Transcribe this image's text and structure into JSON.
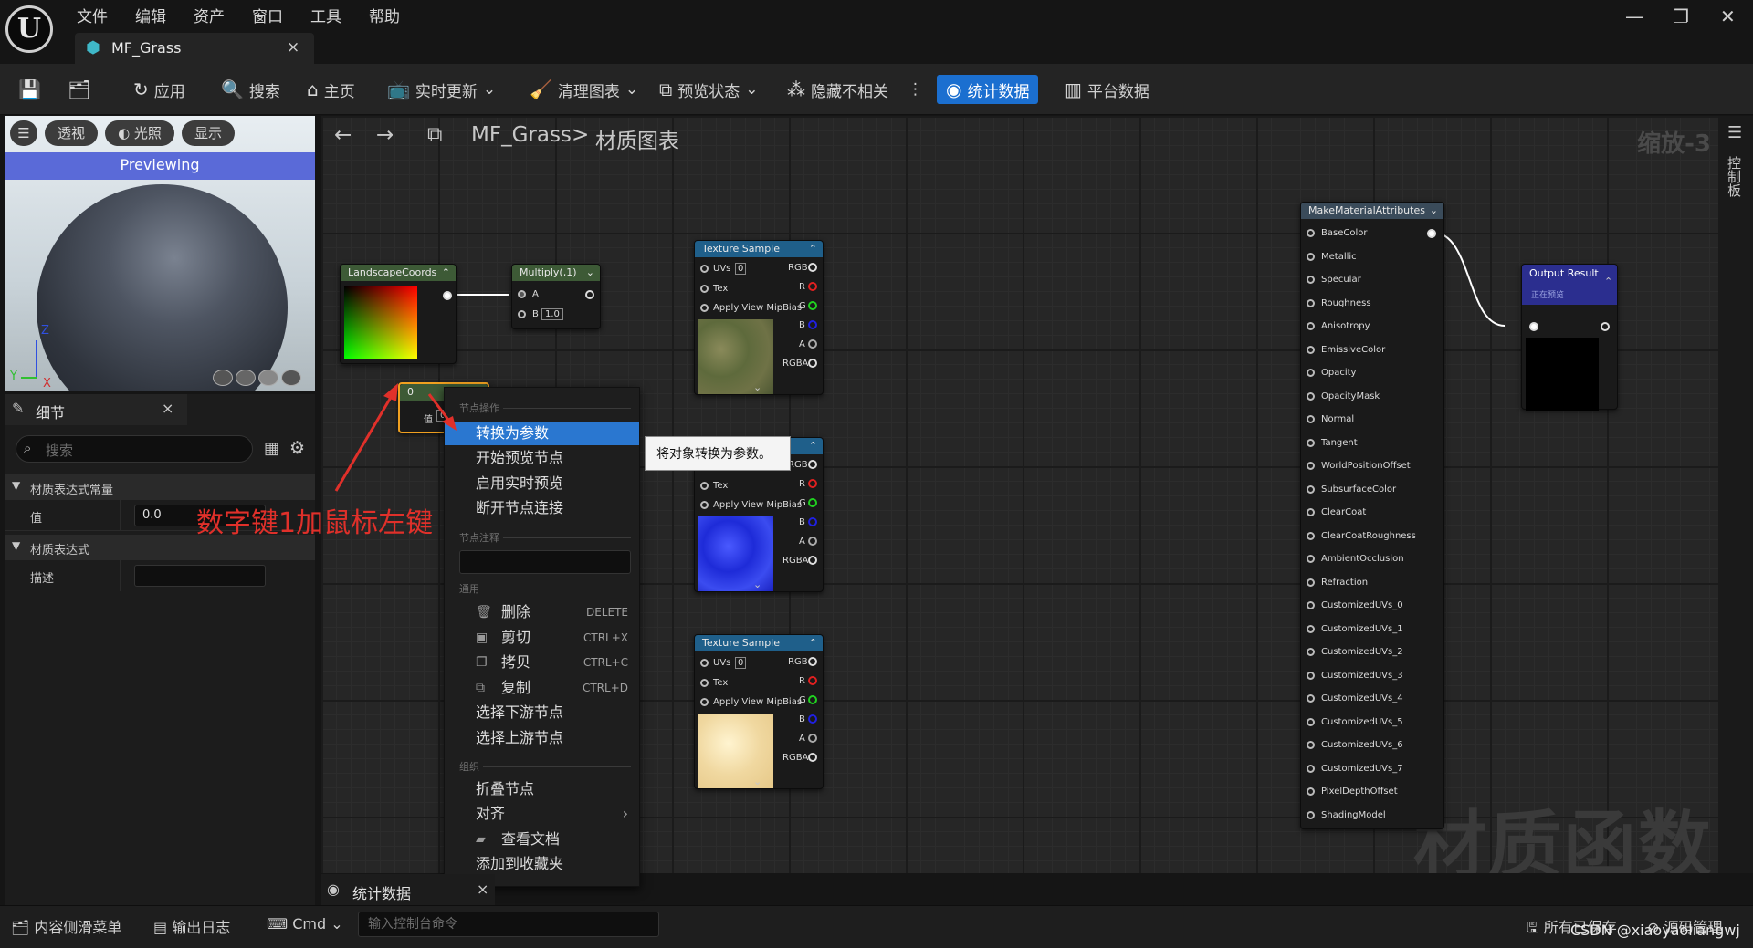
{
  "app": {
    "logo": "U",
    "tab_title": "MF_Grass",
    "tab_close": "×"
  },
  "menu": [
    "文件",
    "编辑",
    "资产",
    "窗口",
    "工具",
    "帮助"
  ],
  "window_controls": {
    "minimize": "—",
    "restore": "❐",
    "close": "✕"
  },
  "toolbar": {
    "apply": "应用",
    "search": "搜索",
    "home": "主页",
    "live_update": "实时更新",
    "clean_graph": "清理图表",
    "preview_state": "预览状态",
    "hide_unrelated": "隐藏不相关",
    "stats": "统计数据",
    "platform_stats": "平台数据"
  },
  "viewport": {
    "menu_icon": "☰",
    "perspective": "透视",
    "lit": "光照",
    "show": "显示",
    "previewing": "Previewing",
    "axis_z": "Z",
    "axis_x": "X",
    "axis_y": "Y"
  },
  "details": {
    "tab_title": "细节",
    "tab_close": "×",
    "search_placeholder": "搜索",
    "section1": "材质表达式常量",
    "value_label": "值",
    "value": "0.0",
    "section2": "材质表达式",
    "desc_label": "描述"
  },
  "graph": {
    "breadcrumb_root": "MF_Grass",
    "breadcrumb_sep": ">",
    "breadcrumb_leaf": "材质图表",
    "zoom": "缩放-3",
    "watermark": "材质函数"
  },
  "nodes": {
    "landscape": {
      "title": "LandscapeCoords"
    },
    "multiply": {
      "title": "Multiply(,1)",
      "pin_a": "A",
      "pin_b": "B",
      "b_value": "1.0"
    },
    "const": {
      "title": "0",
      "value_label": "值",
      "value": "0"
    },
    "texture_sample": {
      "title": "Texture Sample",
      "uvs": "UVs",
      "uvs_val": "0",
      "tex": "Tex",
      "mip": "Apply View MipBias",
      "rgb": "RGB",
      "r": "R",
      "g": "G",
      "b": "B",
      "a": "A",
      "rgba": "RGBA"
    },
    "make_material": {
      "title": "MakeMaterialAttributes",
      "pins": [
        "BaseColor",
        "Metallic",
        "Specular",
        "Roughness",
        "Anisotropy",
        "EmissiveColor",
        "Opacity",
        "OpacityMask",
        "Normal",
        "Tangent",
        "WorldPositionOffset",
        "SubsurfaceColor",
        "ClearCoat",
        "ClearCoatRoughness",
        "AmbientOcclusion",
        "Refraction",
        "CustomizedUVs_0",
        "CustomizedUVs_1",
        "CustomizedUVs_2",
        "CustomizedUVs_3",
        "CustomizedUVs_4",
        "CustomizedUVs_5",
        "CustomizedUVs_6",
        "CustomizedUVs_7",
        "PixelDepthOffset",
        "ShadingModel"
      ]
    },
    "output": {
      "title": "Output Result",
      "subtitle": "正在预览"
    }
  },
  "context_menu": {
    "sec_node_actions": "节点操作",
    "convert_to_param": "转换为参数",
    "start_preview": "开始预览节点",
    "enable_realtime": "启用实时预览",
    "break_links": "断开节点连接",
    "sec_comment": "节点注释",
    "sec_general": "通用",
    "delete": "删除",
    "delete_sc": "DELETE",
    "cut": "剪切",
    "cut_sc": "CTRL+X",
    "copy": "拷贝",
    "copy_sc": "CTRL+C",
    "duplicate": "复制",
    "duplicate_sc": "CTRL+D",
    "select_downstream": "选择下游节点",
    "select_upstream": "选择上游节点",
    "sec_organize": "组织",
    "collapse": "折叠节点",
    "align": "对齐",
    "view_docs": "查看文档",
    "add_favorite": "添加到收藏夹"
  },
  "tooltip": "将对象转换为参数。",
  "annotation": "数字键1加鼠标左键",
  "right_panel": "控制板",
  "stats_tab": {
    "title": "统计数据",
    "close": "×"
  },
  "bottom": {
    "content_drawer": "内容侧滑菜单",
    "output_log": "输出日志",
    "cmd": "Cmd",
    "console_placeholder": "输入控制台命令",
    "all_saved": "所有已保存",
    "source_control": "源码管理",
    "credit": "CSDN @xiaoyaoliangwj"
  },
  "colors": {
    "accent": "#1b6fd0",
    "node_texture_head": "#1f5f8a",
    "node_green_head": "#3d5a36",
    "output_head": "#2b2e8f",
    "annotation": "#e0302a"
  }
}
